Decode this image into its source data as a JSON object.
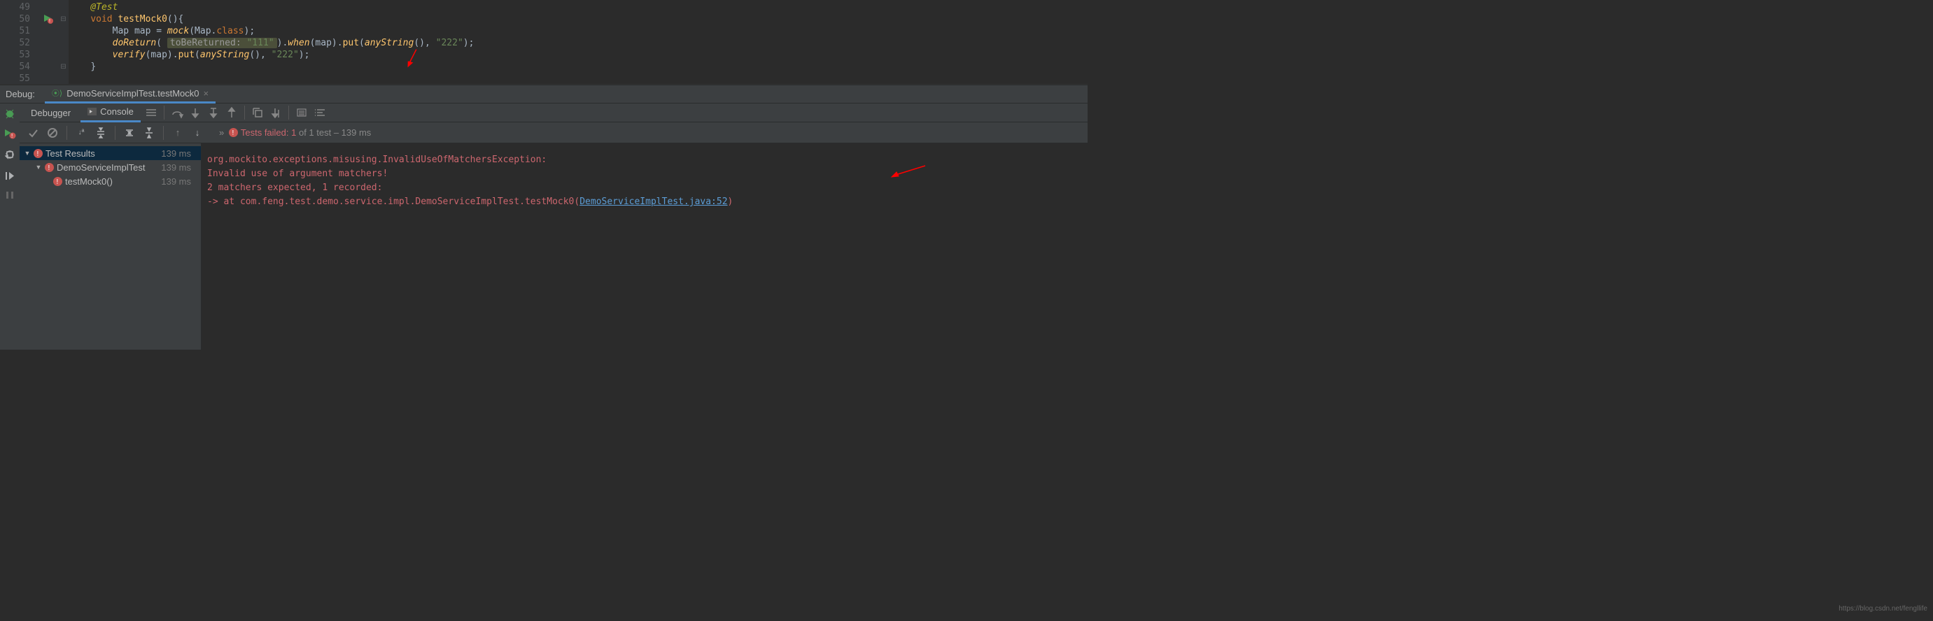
{
  "editor": {
    "lineNumbers": [
      "49",
      "50",
      "51",
      "52",
      "53",
      "54",
      "55"
    ],
    "annotation": "@Test",
    "signature": {
      "kw": "void",
      "name": "testMock0",
      "suffix": "(){"
    },
    "line51": {
      "type": "Map",
      "var": "map = ",
      "fn": "mock",
      "args": "(Map.",
      "class": "class",
      "end": ");"
    },
    "line52": {
      "fn": "doReturn",
      "hintLabel": "toBeReturned:",
      "hintVal": "\"111\"",
      "mid": ").",
      "when": "when",
      "mid2": "(map).",
      "put": "put",
      "arg1fn": "anyString",
      "mid3": "(), ",
      "arg2": "\"222\"",
      "end": ");"
    },
    "line53": {
      "fn": "verify",
      "mid": "(map).",
      "put": "put",
      "arg1fn": "anyString",
      "mid2": "(), ",
      "arg2": "\"222\"",
      "end": ");"
    },
    "closeBrace": "}"
  },
  "debug": {
    "title": "Debug:",
    "tabName": "DemoServiceImplTest.testMock0"
  },
  "innerTabs": {
    "debugger": "Debugger",
    "console": "Console"
  },
  "testStatus": {
    "chev": "»",
    "prefix": "Tests failed: 1",
    "suffix": " of 1 test – 139 ms"
  },
  "tree": {
    "root": {
      "label": "Test Results",
      "time": "139 ms"
    },
    "class": {
      "label": "DemoServiceImplTest",
      "time": "139 ms"
    },
    "method": {
      "label": "testMock0()",
      "time": "139 ms"
    }
  },
  "console": {
    "l1": "org.mockito.exceptions.misusing.InvalidUseOfMatchersException:",
    "l2": "Invalid use of argument matchers!",
    "l3": "2 matchers expected, 1 recorded:",
    "l4a": "-> at com.feng.test.demo.service.impl.DemoServiceImplTest.testMock0(",
    "l4link": "DemoServiceImplTest.java:52",
    "l4b": ")"
  },
  "watermark": "https://blog.csdn.net/fengllife"
}
